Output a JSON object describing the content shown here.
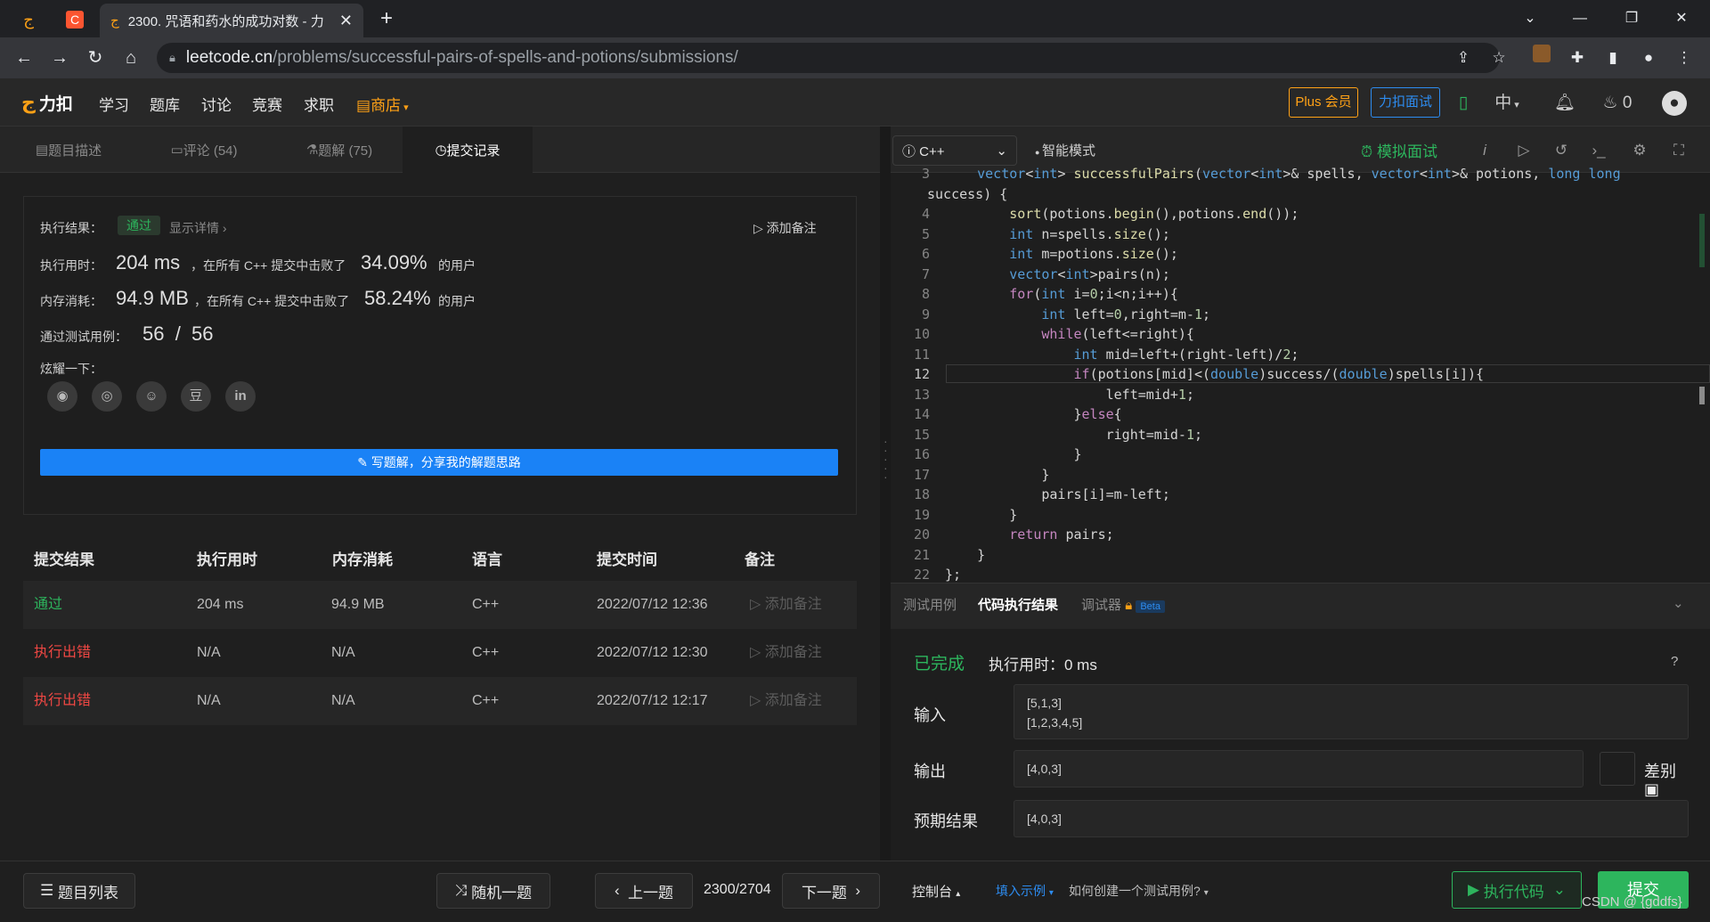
{
  "browser": {
    "tab_title": "2300. 咒语和药水的成功对数 - 力",
    "url_host": "leetcode.cn",
    "url_path": "/problems/successful-pairs-of-spells-and-potions/submissions/"
  },
  "nav": {
    "logo": "力扣",
    "items": [
      "学习",
      "题库",
      "讨论",
      "竞赛",
      "求职"
    ],
    "shop": "商店",
    "plus": "Plus 会员",
    "interview": "力扣面试",
    "lang": "中",
    "points": "0"
  },
  "left_tabs": [
    "题目描述",
    "评论 (54)",
    "题解 (75)",
    "提交记录"
  ],
  "result": {
    "status_label": "执行结果：",
    "status": "通过",
    "show_detail": "显示详情 ›",
    "add_note": "添加备注",
    "time_label": "执行用时：",
    "time_value": "204 ms",
    "time_mid": "，在所有 C++ 提交中击败了",
    "time_pct": "34.09%",
    "users": "的用户",
    "mem_label": "内存消耗：",
    "mem_value": "94.9 MB",
    "mem_mid": "，在所有 C++ 提交中击败了",
    "mem_pct": "58.24%",
    "tests_label": "通过测试用例：",
    "tests_value": "56  /  56",
    "share_label": "炫耀一下：",
    "write_solution": "写题解，分享我的解题思路"
  },
  "table": {
    "headers": [
      "提交结果",
      "执行用时",
      "内存消耗",
      "语言",
      "提交时间",
      "备注"
    ],
    "rows": [
      {
        "result": "通过",
        "time": "204 ms",
        "mem": "94.9 MB",
        "lang": "C++",
        "date": "2022/07/12 12:36",
        "note": "添加备注"
      },
      {
        "result": "执行出错",
        "time": "N/A",
        "mem": "N/A",
        "lang": "C++",
        "date": "2022/07/12 12:30",
        "note": "添加备注"
      },
      {
        "result": "执行出错",
        "time": "N/A",
        "mem": "N/A",
        "lang": "C++",
        "date": "2022/07/12 12:17",
        "note": "添加备注"
      }
    ]
  },
  "bottom": {
    "list": "题目列表",
    "random": "随机一题",
    "prev": "上一题",
    "pager": "2300/2704",
    "next": "下一题",
    "console": "控制台",
    "fill_example": "填入示例",
    "how_to": "如何创建一个测试用例?",
    "run": "执行代码",
    "submit": "提交"
  },
  "editor": {
    "language": "C++",
    "smart_mode": "智能模式",
    "mock": "模拟面试",
    "line_numbers": [
      "3",
      "",
      "4",
      "5",
      "6",
      "7",
      "8",
      "9",
      "10",
      "11",
      "12",
      "13",
      "14",
      "15",
      "16",
      "17",
      "18",
      "19",
      "20",
      "21",
      "22"
    ]
  },
  "console": {
    "tabs": [
      "测试用例",
      "代码执行结果",
      "调试器"
    ],
    "beta": "Beta",
    "done": "已完成",
    "exec_time": "执行用时：0 ms",
    "input_label": "输入",
    "input_value_1": "[5,1,3]",
    "input_value_2": "[1,2,3,4,5]",
    "output_label": "输出",
    "output_value": "[4,0,3]",
    "diff": "差别",
    "expected_label": "预期结果",
    "expected_value": "[4,0,3]"
  },
  "watermark": "CSDN @ {gddfs}"
}
